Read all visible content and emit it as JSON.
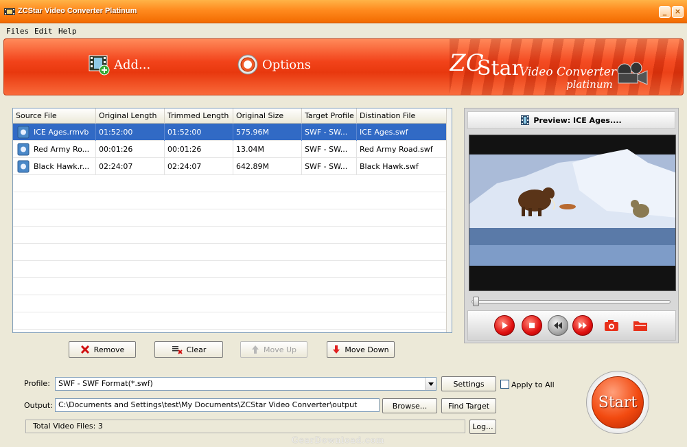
{
  "window": {
    "title": "ZCStar Video Converter Platinum",
    "minimize": "_",
    "close": "×"
  },
  "menu": [
    "Files",
    "Edit",
    "Help"
  ],
  "toolbar": {
    "add_label": "Add...",
    "options_label": "Options"
  },
  "logo": {
    "brand_zc": "ZC",
    "brand_star": "Star",
    "line1": "Video Converter",
    "line2": "platinum"
  },
  "table": {
    "columns": [
      "Source File",
      "Original Length",
      "Trimmed Length",
      "Original Size",
      "Target Profile",
      "Distination File"
    ],
    "rows": [
      [
        "ICE Ages.rmvb",
        "01:52:00",
        "01:52:00",
        "575.96M",
        "SWF - SW...",
        "ICE Ages.swf"
      ],
      [
        "Red Army Ro...",
        "00:01:26",
        "00:01:26",
        "13.04M",
        "SWF - SW...",
        "Red Army Road.swf"
      ],
      [
        "Black Hawk.r...",
        "02:24:07",
        "02:24:07",
        "642.89M",
        "SWF - SW...",
        "Black Hawk.swf"
      ]
    ],
    "selected_row": 0
  },
  "actions": {
    "remove": "Remove",
    "clear": "Clear",
    "move_up": "Move Up",
    "move_down": "Move Down"
  },
  "preview": {
    "title": "Preview: ICE Ages....",
    "seek_position": 0.0
  },
  "settings": {
    "profile_label": "Profile:",
    "profile_value": "SWF - SWF Format(*.swf)",
    "settings_button": "Settings",
    "apply_to_all": "Apply to All",
    "output_label": "Output:",
    "output_value": "C:\\Documents and Settings\\test\\My Documents\\ZCStar Video Converter\\output",
    "browse_button": "Browse...",
    "find_target_button": "Find Target",
    "status": "Total Video Files: 3",
    "log_button": "Log..."
  },
  "start_label": "Start",
  "watermark": "GearDownload.com",
  "colors": {
    "accent": "#f2431a",
    "selection": "#316ac5",
    "titlebar": "#ff8a1e"
  }
}
